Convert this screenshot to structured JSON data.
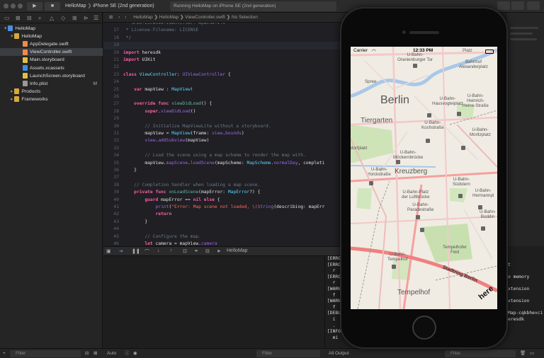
{
  "toolbar": {
    "scheme": "HelloMap",
    "device": "iPhone SE (2nd generation)",
    "status": "Running HelloMap on iPhone SE (2nd generation)"
  },
  "navigator": {
    "items": [
      {
        "label": "HelloMap",
        "depth": 0,
        "kind": "project",
        "expanded": true
      },
      {
        "label": "HelloMap",
        "depth": 1,
        "kind": "folder",
        "expanded": true
      },
      {
        "label": "AppDelegate.swift",
        "depth": 2,
        "kind": "swift"
      },
      {
        "label": "ViewController.swift",
        "depth": 2,
        "kind": "swift",
        "selected": true
      },
      {
        "label": "Main.storyboard",
        "depth": 2,
        "kind": "storyboard"
      },
      {
        "label": "Assets.xcassets",
        "depth": 2,
        "kind": "assets"
      },
      {
        "label": "LaunchScreen.storyboard",
        "depth": 2,
        "kind": "storyboard"
      },
      {
        "label": "Info.plist",
        "depth": 2,
        "kind": "plist",
        "badge": "M"
      },
      {
        "label": "Products",
        "depth": 1,
        "kind": "folder",
        "expanded": false
      },
      {
        "label": "Frameworks",
        "depth": 1,
        "kind": "folder",
        "expanded": false
      }
    ],
    "filter_placeholder": "Filter"
  },
  "jumpbar": {
    "crumbs": [
      "HelloMap",
      "HelloMap",
      "ViewController.swift",
      "No Selection"
    ]
  },
  "editor": {
    "highlighted_line": 19,
    "lines": [
      {
        "n": "",
        "tokens": [
          [
            "cm",
            " * SPDX-License-Identifier: Apache-2.0"
          ]
        ]
      },
      {
        "n": "17",
        "tokens": [
          [
            "cm",
            " * License-Filename: LICENSE"
          ]
        ]
      },
      {
        "n": "18",
        "tokens": [
          [
            "cm",
            " */"
          ]
        ]
      },
      {
        "n": "19",
        "tokens": []
      },
      {
        "n": "20",
        "tokens": [
          [
            "kw",
            "import"
          ],
          [
            "tx",
            " heresdk"
          ]
        ]
      },
      {
        "n": "21",
        "tokens": [
          [
            "kw",
            "import"
          ],
          [
            "tx",
            " UIKit"
          ]
        ]
      },
      {
        "n": "22",
        "tokens": []
      },
      {
        "n": "23",
        "tokens": [
          [
            "kw",
            "class"
          ],
          [
            "tx",
            " "
          ],
          [
            "ty",
            "ViewController"
          ],
          [
            "tx",
            ": "
          ],
          [
            "pr",
            "UIViewController"
          ],
          [
            "tx",
            " {"
          ]
        ]
      },
      {
        "n": "24",
        "tokens": []
      },
      {
        "n": "25",
        "tokens": [
          [
            "tx",
            "    "
          ],
          [
            "kw",
            "var"
          ],
          [
            "tx",
            " mapView : "
          ],
          [
            "ty",
            "MapView"
          ],
          [
            "tx",
            "!"
          ]
        ]
      },
      {
        "n": "26",
        "tokens": []
      },
      {
        "n": "27",
        "tokens": [
          [
            "tx",
            "    "
          ],
          [
            "kw",
            "override func"
          ],
          [
            "tx",
            " "
          ],
          [
            "fn",
            "viewDidLoad"
          ],
          [
            "tx",
            "() {"
          ]
        ]
      },
      {
        "n": "28",
        "tokens": [
          [
            "tx",
            "        "
          ],
          [
            "kw",
            "super"
          ],
          [
            "tx",
            "."
          ],
          [
            "pr",
            "viewDidLoad"
          ],
          [
            "tx",
            "()"
          ]
        ]
      },
      {
        "n": "29",
        "tokens": []
      },
      {
        "n": "30",
        "tokens": [
          [
            "tx",
            "        "
          ],
          [
            "cm",
            "// Initialize MapViewLite without a storyboard."
          ]
        ]
      },
      {
        "n": "31",
        "tokens": [
          [
            "tx",
            "        mapView = "
          ],
          [
            "ty",
            "MapView"
          ],
          [
            "tx",
            "(frame: "
          ],
          [
            "pr",
            "view"
          ],
          [
            "tx",
            "."
          ],
          [
            "pr",
            "bounds"
          ],
          [
            "tx",
            ")"
          ]
        ]
      },
      {
        "n": "32",
        "tokens": [
          [
            "tx",
            "        "
          ],
          [
            "pr",
            "view"
          ],
          [
            "tx",
            "."
          ],
          [
            "pr",
            "addSubview"
          ],
          [
            "tx",
            "(mapView)"
          ]
        ]
      },
      {
        "n": "33",
        "tokens": []
      },
      {
        "n": "34",
        "tokens": [
          [
            "tx",
            "        "
          ],
          [
            "cm",
            "// Load the scene using a map scheme to render the map with."
          ]
        ]
      },
      {
        "n": "35",
        "tokens": [
          [
            "tx",
            "        mapView."
          ],
          [
            "pr",
            "mapScene"
          ],
          [
            "tx",
            "."
          ],
          [
            "pr",
            "loadScene"
          ],
          [
            "tx",
            "(mapScheme: "
          ],
          [
            "ty",
            "MapScheme"
          ],
          [
            "tx",
            "."
          ],
          [
            "pr",
            "normalDay"
          ],
          [
            "tx",
            ", completi"
          ]
        ]
      },
      {
        "n": "36",
        "tokens": [
          [
            "tx",
            "    }"
          ]
        ]
      },
      {
        "n": "37",
        "tokens": []
      },
      {
        "n": "38",
        "tokens": [
          [
            "tx",
            "    "
          ],
          [
            "cm",
            "// Completion handler when loading a map scene."
          ]
        ]
      },
      {
        "n": "39",
        "tokens": [
          [
            "tx",
            "    "
          ],
          [
            "kw",
            "private func"
          ],
          [
            "tx",
            " "
          ],
          [
            "fn",
            "onLoadScene"
          ],
          [
            "tx",
            "(mapError: "
          ],
          [
            "ty",
            "MapError"
          ],
          [
            "tx",
            "?) {"
          ]
        ]
      },
      {
        "n": "40",
        "tokens": [
          [
            "tx",
            "        "
          ],
          [
            "kw",
            "guard"
          ],
          [
            "tx",
            " mapError == "
          ],
          [
            "kw",
            "nil"
          ],
          [
            "tx",
            " "
          ],
          [
            "kw",
            "else"
          ],
          [
            "tx",
            " {"
          ]
        ]
      },
      {
        "n": "41",
        "tokens": [
          [
            "tx",
            "            "
          ],
          [
            "pr",
            "print"
          ],
          [
            "tx",
            "("
          ],
          [
            "st",
            "\"Error: Map scene not loaded, \\("
          ],
          [
            "pr",
            "String"
          ],
          [
            "tx",
            "(describing: mapErr"
          ]
        ]
      },
      {
        "n": "42",
        "tokens": [
          [
            "tx",
            "            "
          ],
          [
            "kw",
            "return"
          ]
        ]
      },
      {
        "n": "43",
        "tokens": [
          [
            "tx",
            "        }"
          ]
        ]
      },
      {
        "n": "44",
        "tokens": []
      },
      {
        "n": "45",
        "tokens": [
          [
            "tx",
            "        "
          ],
          [
            "cm",
            "// Configure the map."
          ]
        ]
      },
      {
        "n": "46",
        "tokens": [
          [
            "tx",
            "        "
          ],
          [
            "kw",
            "let"
          ],
          [
            "tx",
            " camera = mapView."
          ],
          [
            "pr",
            "camera"
          ]
        ]
      },
      {
        "n": "47",
        "tokens": [
          [
            "tx",
            "        camera."
          ],
          [
            "pr",
            "lookAt"
          ],
          [
            "tx",
            "(point: "
          ],
          [
            "ty",
            "GeoCoordinates"
          ],
          [
            "tx",
            "(latitude: "
          ],
          [
            "nu",
            "52.518043"
          ],
          [
            "tx",
            ", longitude:"
          ]
        ]
      },
      {
        "n": "48",
        "tokens": [
          [
            "tx",
            "                      distanceInMeters: "
          ],
          [
            "nu",
            "1000"
          ],
          [
            "tx",
            " * "
          ],
          [
            "nu",
            "10"
          ],
          [
            "tx",
            ")"
          ]
        ]
      },
      {
        "n": "49",
        "tokens": [
          [
            "tx",
            "    }"
          ]
        ]
      }
    ]
  },
  "debugbar": {
    "target": "HelloMap"
  },
  "console": {
    "lines": [
      "[ERRO",
      "[ERRO",
      "  r",
      "[ERRO",
      "  r",
      "[WARN",
      "  f",
      "[WARN",
      "  f",
      "[DEBU",
      "  i",
      "  .",
      "[INFO",
      "  mi"
    ],
    "right_lines": [
      {
        "text": "t",
        "row": 1
      },
      {
        "text": "o memory",
        "row": 3
      },
      {
        "text": "xtension",
        "row": 5
      },
      {
        "text": "xtension",
        "row": 7
      },
      {
        "text": "Map-cqkbhevci",
        "row": 9
      },
      {
        "text": "eresdk",
        "row": 10
      }
    ]
  },
  "bottom": {
    "auto_label": "Auto",
    "output_label": "All Output",
    "filter": "Filter"
  },
  "simulator": {
    "status_bar": {
      "carrier": "Carrier",
      "time": "12:33 PM"
    },
    "map_labels": [
      {
        "text": "Berlin",
        "size": "big"
      },
      {
        "text": "Tiergarten",
        "size": "med"
      },
      {
        "text": "Kreuzberg",
        "size": "med"
      },
      {
        "text": "Tempelhof",
        "size": "med"
      },
      {
        "text": "Platz",
        "size": "sm"
      },
      {
        "text": "U-Bahn-\nOranienburger Tor",
        "size": "sm"
      },
      {
        "text": "Bahnhof\nAlexanderplatz",
        "size": "sm"
      },
      {
        "text": "U-Bahn-\nHausvogteiplatz",
        "size": "sm"
      },
      {
        "text": "U-Bahn-\nHeinrich-\nHeine-Straße",
        "size": "sm"
      },
      {
        "text": "U-Bahn-\nKochstraße",
        "size": "sm"
      },
      {
        "text": "U-Bahn-\nMoritzplatz",
        "size": "sm"
      },
      {
        "text": "U-Bahn-\nMöckernbrücke",
        "size": "sm"
      },
      {
        "text": "U-Bahn-\nYorckstraße",
        "size": "sm"
      },
      {
        "text": "U-Bahn-\nSüdstern",
        "size": "sm"
      },
      {
        "text": "U-Bahn-Platz\nder Luftbrücke",
        "size": "sm"
      },
      {
        "text": "U-Bahn-\nHermannpl",
        "size": "sm"
      },
      {
        "text": "U-Bahn-\nParadestraße",
        "size": "sm"
      },
      {
        "text": "Tempelhofer\nFeld",
        "size": "sm"
      },
      {
        "text": "U-Bahn-\nTempelhof",
        "size": "sm"
      },
      {
        "text": "U-Bahn-\nBoddin",
        "size": "sm"
      },
      {
        "text": "dorfplatz",
        "size": "sm"
      },
      {
        "text": "Spree",
        "size": "sm"
      },
      {
        "text": "Stadtring Berlin",
        "size": "road"
      },
      {
        "text": "here",
        "size": "logo"
      }
    ]
  }
}
